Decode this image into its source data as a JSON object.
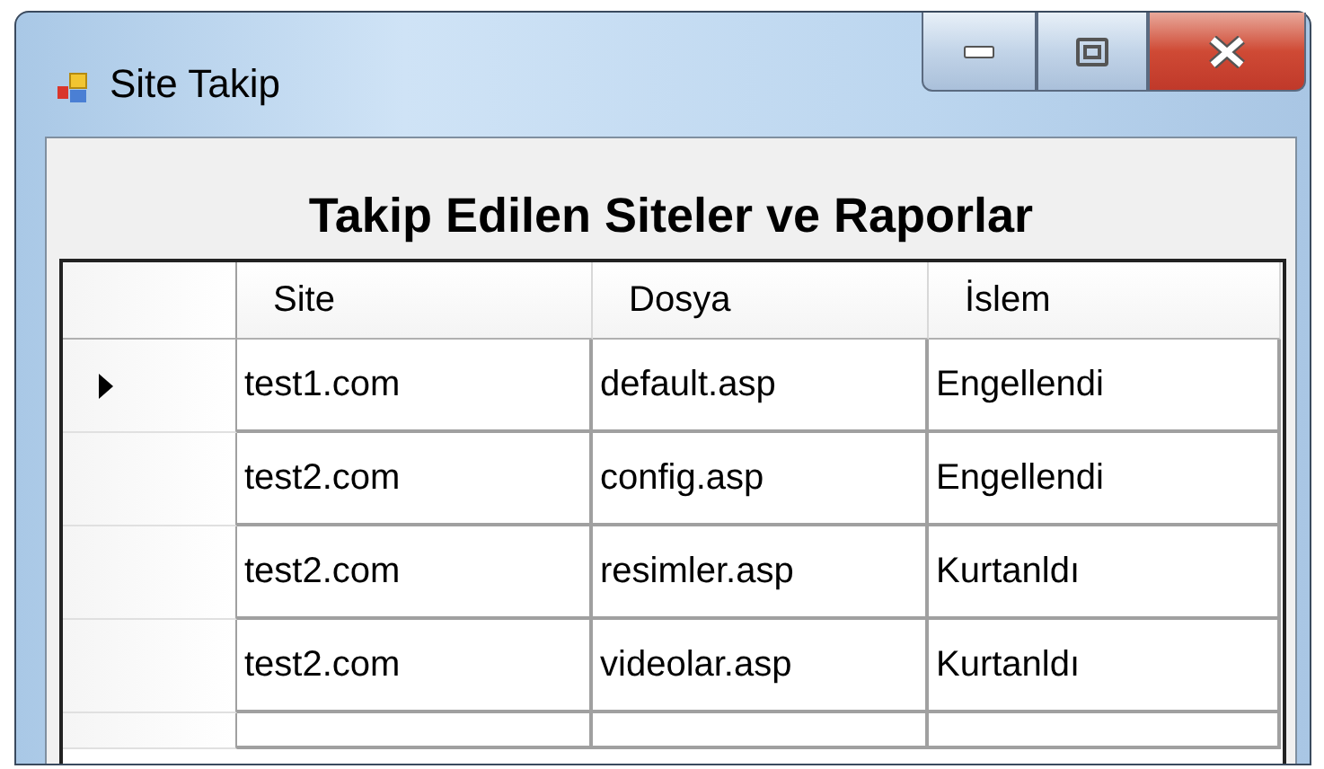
{
  "window": {
    "title": "Site Takip"
  },
  "heading": "Takip Edilen Siteler ve Raporlar",
  "table": {
    "columns": [
      "Site",
      "Dosya",
      "İslem"
    ],
    "rows": [
      {
        "selected": true,
        "cells": [
          "test1.com",
          "default.asp",
          "Engellendi"
        ]
      },
      {
        "selected": false,
        "cells": [
          "test2.com",
          "config.asp",
          "Engellendi"
        ]
      },
      {
        "selected": false,
        "cells": [
          "test2.com",
          "resimler.asp",
          "Kurtanldı"
        ]
      },
      {
        "selected": false,
        "cells": [
          "test2.com",
          "videolar.asp",
          "Kurtanldı"
        ]
      }
    ]
  }
}
